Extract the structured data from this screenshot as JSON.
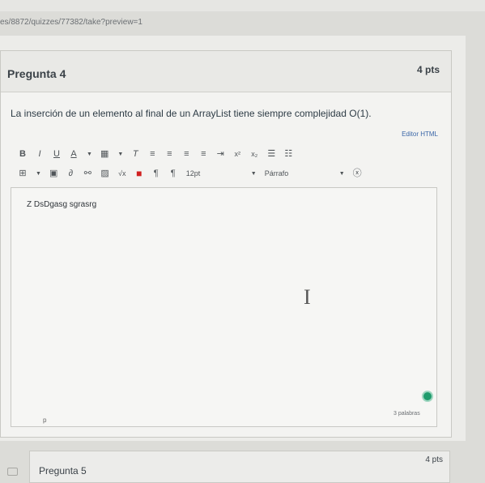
{
  "browser": {
    "url": "es/8872/quizzes/77382/take?preview=1"
  },
  "question4": {
    "title": "Pregunta 4",
    "points": "4 pts",
    "text": "La inserción de un elemento al final de un ArrayList tiene siempre complejidad O(1).",
    "html_editor_link": "Editor HTML",
    "toolbar_row1": [
      {
        "name": "bold-button",
        "glyph": "B",
        "icon": "bold-icon"
      },
      {
        "name": "italic-button",
        "glyph": "I",
        "icon": "italic-icon"
      },
      {
        "name": "underline-button",
        "glyph": "U",
        "icon": "underline-icon"
      },
      {
        "name": "text-color-button",
        "glyph": "A",
        "icon": "text-color-icon"
      },
      {
        "name": "bg-color-button",
        "glyph": "▦",
        "icon": "background-color-icon"
      },
      {
        "name": "clear-format-button",
        "glyph": "T̸",
        "icon": "clear-format-icon"
      },
      {
        "name": "align-left-button",
        "glyph": "≡",
        "icon": "align-left-icon"
      },
      {
        "name": "align-center-button",
        "glyph": "≡",
        "icon": "align-center-icon"
      },
      {
        "name": "align-right-button",
        "glyph": "≡",
        "icon": "align-right-icon"
      },
      {
        "name": "justify-button",
        "glyph": "≡",
        "icon": "justify-icon"
      },
      {
        "name": "indent-button",
        "glyph": "⇥",
        "icon": "indent-icon"
      },
      {
        "name": "superscript-button",
        "glyph": "x²",
        "icon": "superscript-icon"
      },
      {
        "name": "subscript-button",
        "glyph": "x₂",
        "icon": "subscript-icon"
      },
      {
        "name": "bullet-list-button",
        "glyph": "☰",
        "icon": "bullet-list-icon"
      },
      {
        "name": "numbered-list-button",
        "glyph": "⒈",
        "icon": "numbered-list-icon"
      }
    ],
    "toolbar_row2": [
      {
        "name": "table-button",
        "glyph": "⊞",
        "icon": "table-icon"
      },
      {
        "name": "media-button",
        "glyph": "▣",
        "icon": "media-icon"
      },
      {
        "name": "link-button",
        "glyph": "🔗",
        "icon": "link-icon"
      },
      {
        "name": "unlink-button",
        "glyph": "⚯",
        "icon": "unlink-icon"
      },
      {
        "name": "image-button",
        "glyph": "🖼",
        "icon": "image-icon"
      },
      {
        "name": "equation-button",
        "glyph": "√x",
        "icon": "equation-icon"
      },
      {
        "name": "record-button",
        "glyph": "■",
        "icon": "record-media-icon"
      },
      {
        "name": "ltr-button",
        "glyph": "¶",
        "icon": "ltr-icon"
      },
      {
        "name": "rtl-button",
        "glyph": "¶",
        "icon": "rtl-icon"
      }
    ],
    "font_size": "12pt",
    "paragraph_format": "Párrafo",
    "accessibility_icon": "accessibility-checker-icon",
    "answer_text": "Z DsDgasg sgrasrg",
    "word_count": "3 palabras",
    "status_dot_color": "#1f9b6c",
    "paragraph_tag": "p"
  },
  "question5": {
    "title": "Pregunta 5",
    "points": "4 pts"
  }
}
